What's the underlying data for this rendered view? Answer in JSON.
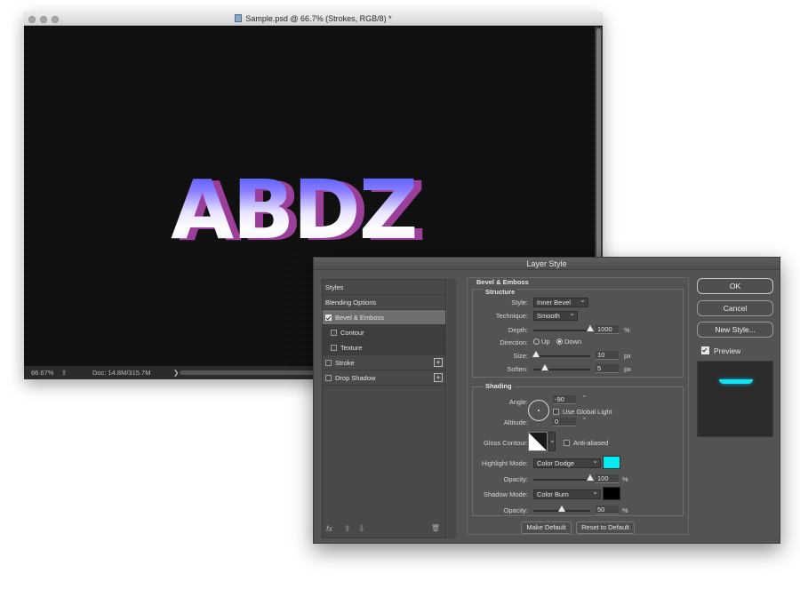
{
  "document": {
    "title": "Sample.psd @ 66.7% (Strokes, RGB/8) *",
    "artwork_text": "ABDZ",
    "status": {
      "zoom": "66.67%",
      "doc_info": "Doc: 14.8M/315.7M",
      "arrow": "❯"
    }
  },
  "dialog": {
    "title": "Layer Style",
    "styles": [
      {
        "label": "Styles",
        "checkbox": false,
        "checked": false,
        "selected": false,
        "sub": false,
        "plus": false
      },
      {
        "label": "Blending Options",
        "checkbox": false,
        "checked": false,
        "selected": false,
        "sub": false,
        "plus": false
      },
      {
        "label": "Bevel & Emboss",
        "checkbox": true,
        "checked": true,
        "selected": true,
        "sub": false,
        "plus": false
      },
      {
        "label": "Contour",
        "checkbox": true,
        "checked": false,
        "selected": false,
        "sub": true,
        "plus": false
      },
      {
        "label": "Texture",
        "checkbox": true,
        "checked": false,
        "selected": false,
        "sub": true,
        "plus": false
      },
      {
        "label": "Stroke",
        "checkbox": true,
        "checked": false,
        "selected": false,
        "sub": false,
        "plus": true
      },
      {
        "label": "Drop Shadow",
        "checkbox": true,
        "checked": false,
        "selected": false,
        "sub": false,
        "plus": true
      }
    ],
    "footer_icons": {
      "fx": "fx",
      "up": "⇧",
      "down": "⇩",
      "trash": "🗑"
    },
    "bevel": {
      "heading": "Bevel & Emboss",
      "structure_heading": "Structure",
      "style_label": "Style:",
      "style_value": "Inner Bevel",
      "technique_label": "Technique:",
      "technique_value": "Smooth",
      "depth_label": "Depth:",
      "depth_value": "1000",
      "depth_unit": "%",
      "depth_pos": 1.0,
      "direction_label": "Direction:",
      "direction_up": "Up",
      "direction_down": "Down",
      "direction_selected": "Down",
      "size_label": "Size:",
      "size_value": "10",
      "size_unit": "px",
      "size_pos": 0.05,
      "soften_label": "Soften:",
      "soften_value": "5",
      "soften_unit": "px",
      "soften_pos": 0.2
    },
    "shading": {
      "heading": "Shading",
      "angle_label": "Angle:",
      "angle_value": "-90",
      "angle_unit": "°",
      "global_light_label": "Use Global Light",
      "altitude_label": "Altitude:",
      "altitude_value": "0",
      "altitude_unit": "°",
      "gloss_label": "Gloss Contour:",
      "anti_aliased_label": "Anti-aliased",
      "highlight_label": "Highlight Mode:",
      "highlight_value": "Color Dodge",
      "highlight_color": "#00ecf4",
      "hl_opacity_label": "Opacity:",
      "hl_opacity_value": "100",
      "hl_opacity_unit": "%",
      "hl_opacity_pos": 1.0,
      "shadow_label": "Shadow Mode:",
      "shadow_value": "Color Burn",
      "shadow_color": "#000000",
      "sh_opacity_label": "Opacity:",
      "sh_opacity_value": "50",
      "sh_opacity_unit": "%",
      "sh_opacity_pos": 0.5
    },
    "make_default": "Make Default",
    "reset_default": "Reset to Default",
    "ok": "OK",
    "cancel": "Cancel",
    "new_style": "New Style...",
    "preview_label": "Preview",
    "preview_checked": true
  }
}
